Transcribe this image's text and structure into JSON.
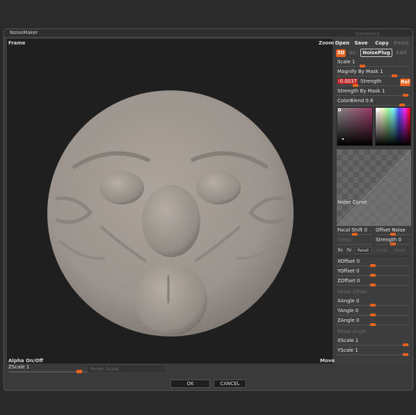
{
  "dialog": {
    "title": "NoiseMaker",
    "geometry_label": "Geometry"
  },
  "viewport": {
    "frame_label": "Frame",
    "zoom_label": "Zoom",
    "alpha_label": "Alpha On/Off",
    "move_label": "Move"
  },
  "bottom": {
    "zscale_label": "ZScale 1",
    "zscale_value": 0.92,
    "reset_scale_label": "Reset Scale",
    "ok_label": "OK",
    "cancel_label": "CANCEL"
  },
  "panel": {
    "file_buttons": {
      "open": "Open",
      "save": "Save",
      "copy": "Copy",
      "paste": "Paste"
    },
    "mode_buttons": {
      "d3": "3D",
      "uv": "Uv",
      "noiseplug": "NoisePlug",
      "edit": "Edit"
    },
    "scale_label": "Scale 1",
    "scale_value": 0.35,
    "magnify_label": "Magnify By Mask 1",
    "magnify_value": 0.82,
    "strength_value": "-0.0037",
    "strength_label": "Strength",
    "strength_slider": 0.24,
    "rel_label": "Rel",
    "strength_mask_label": "Strength By Mask 1",
    "strength_mask_value": 0.98,
    "colorblend_label": "ColorBlend 0.6",
    "colorblend_value": 0.93,
    "noise_curve_label": "Noise Curve",
    "focal_shift_label": "Focal Shift 0",
    "focal_shift_value": 0.5,
    "offset_noise_label": "Offset Noise",
    "offset_noise_value": 0.5,
    "steps_label": "Steps",
    "strength2_label": "Strength 0",
    "strength2_value": 0.5,
    "fh_label": "fH",
    "fv_label": "fV",
    "reset_label": "Reset",
    "undo_label": "Undo",
    "redo_label": "Redo",
    "xoffset_label": "XOffset 0",
    "xoffset_value": 0.5,
    "yoffset_label": "YOffset 0",
    "yoffset_value": 0.5,
    "zoffset_label": "ZOffset 0",
    "zoffset_value": 0.5,
    "reset_offset_label": "Reset Offset",
    "xangle_label": "XAngle 0",
    "xangle_value": 0.5,
    "yangle_label": "YAngle 0",
    "yangle_value": 0.5,
    "zangle_label": "ZAngle 0",
    "zangle_value": 0.5,
    "reset_angle_label": "Reset Angle",
    "xscale_label": "XScale 1",
    "xscale_value": 0.98,
    "yscale_label": "YScale 1",
    "yscale_value": 0.98
  },
  "colors": {
    "accent": "#e8641e",
    "panel_bg": "#3d3d3d",
    "viewport_bg": "#1f1f1f",
    "disc": "#a59c93"
  }
}
